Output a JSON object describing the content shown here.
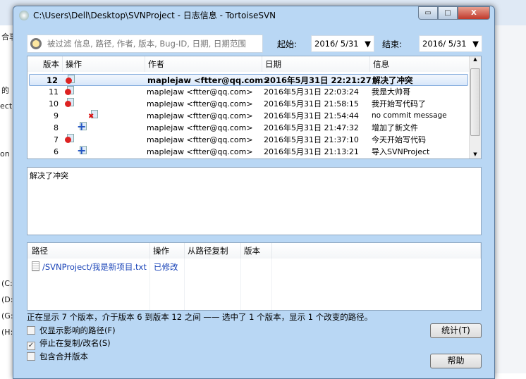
{
  "background": {
    "fragments": [
      "合享",
      "的",
      "ect",
      "on",
      "(C:",
      "(D:",
      "(G:",
      "(H:"
    ]
  },
  "window": {
    "title": "C:\\Users\\Dell\\Desktop\\SVNProject - 日志信息 - TortoiseSVN",
    "minimize": "▭",
    "maximize": "□",
    "close": "X"
  },
  "filter": {
    "placeholder": "被过滤 信息, 路径, 作者, 版本, Bug-ID, 日期, 日期范围",
    "start_label": "起始:",
    "start_value": "2016/  5/31",
    "end_label": "结束:",
    "end_value": "2016/  5/31"
  },
  "log": {
    "columns": [
      "版本",
      "操作",
      "作者",
      "日期",
      "信息"
    ],
    "rows": [
      {
        "rev": "12",
        "action": "modified",
        "author": "maplejaw <ftter@qq.com>",
        "date": "2016年5月31日 22:21:27",
        "msg": "解决了冲突",
        "selected": true
      },
      {
        "rev": "11",
        "action": "modified",
        "author": "maplejaw <ftter@qq.com>",
        "date": "2016年5月31日 22:03:24",
        "msg": "我是大帅哥"
      },
      {
        "rev": "10",
        "action": "modified",
        "author": "maplejaw <ftter@qq.com>",
        "date": "2016年5月31日 21:58:15",
        "msg": "我开始写代码了"
      },
      {
        "rev": "9",
        "action": "deleted",
        "author": "maplejaw <ftter@qq.com>",
        "date": "2016年5月31日 21:54:44",
        "msg": "no commit message"
      },
      {
        "rev": "8",
        "action": "added",
        "author": "maplejaw <ftter@qq.com>",
        "date": "2016年5月31日 21:47:32",
        "msg": "增加了新文件"
      },
      {
        "rev": "7",
        "action": "modified",
        "author": "maplejaw <ftter@qq.com>",
        "date": "2016年5月31日 21:37:10",
        "msg": "今天开始写代码"
      },
      {
        "rev": "6",
        "action": "added",
        "author": "maplejaw <ftter@qq.com>",
        "date": "2016年5月31日 21:13:21",
        "msg": "导入SVNProject"
      }
    ]
  },
  "message": "解决了冲突",
  "paths": {
    "columns": [
      "路径",
      "操作",
      "从路径复制",
      "版本"
    ],
    "rows": [
      {
        "path": "/SVNProject/我是新项目.txt",
        "action": "已修改"
      }
    ]
  },
  "status": "正在显示 7 个版本，介于版本 6 到版本 12 之间 —— 选中了 1 个版本，显示 1 个改变的路径。",
  "options": [
    {
      "label": "仅显示影响的路径(F)",
      "checked": false
    },
    {
      "label": "停止在复制/改名(S)",
      "checked": true
    },
    {
      "label": "包含合并版本",
      "checked": false
    }
  ],
  "buttons": {
    "stats": "统计(T)",
    "help": "帮助"
  },
  "colors": {
    "dialog": "#b9d7f4",
    "link": "#1a44b8"
  }
}
